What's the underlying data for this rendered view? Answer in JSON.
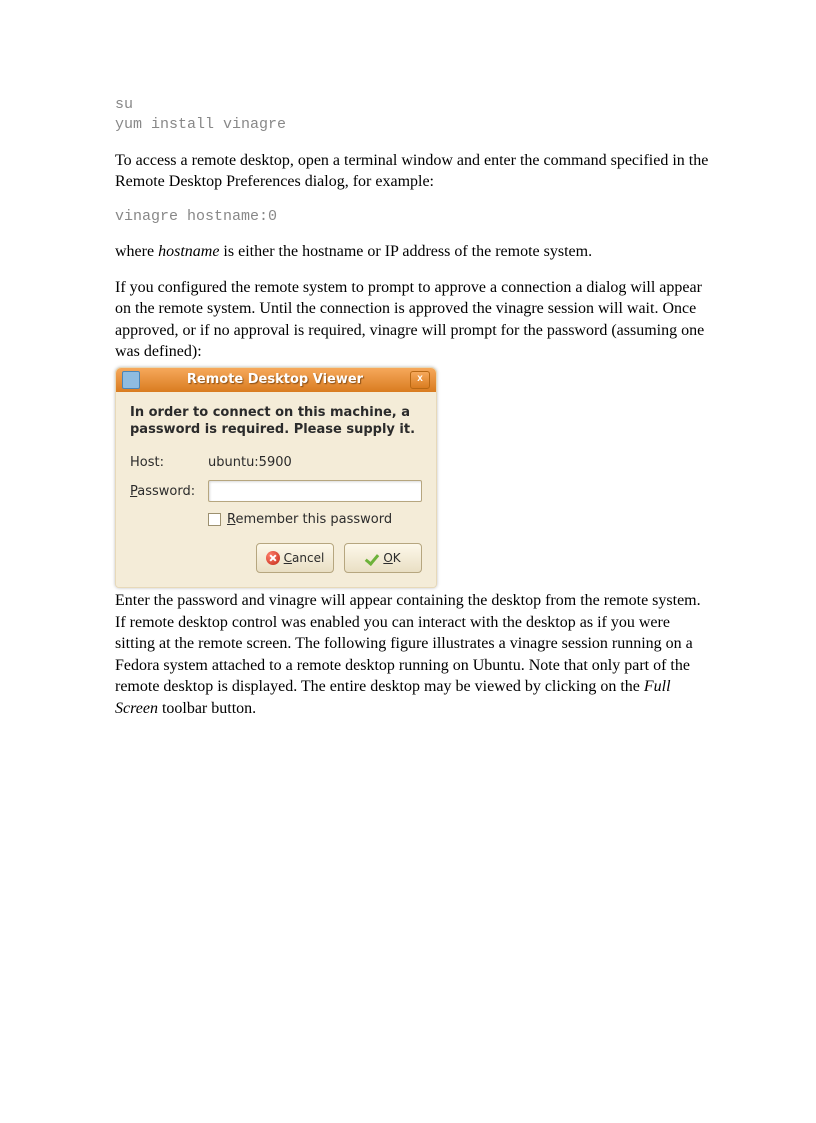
{
  "code": {
    "line1": "su",
    "line2": "yum install vinagre",
    "line3": "vinagre hostname:0"
  },
  "text": {
    "p1": "To access a remote desktop, open a terminal window and enter the command specified in the Remote Desktop Preferences dialog, for example:",
    "p2a": "where ",
    "p2i": "hostname",
    "p2b": " is either the hostname or IP address of the remote system.",
    "p3": "If you configured the remote system to prompt to approve a connection a dialog will appear on the remote system. Until the connection is approved the vinagre session will wait. Once approved, or if no approval is required, vinagre will prompt for the password (assuming one was defined):",
    "p4a": "Enter the password and vinagre will appear containing the desktop from the remote system. If remote desktop control was enabled you can interact with the desktop as if you were sitting at the remote screen. The following figure illustrates a vinagre session running on a Fedora system attached to a remote desktop running on Ubuntu. Note that only part of the remote desktop is displayed. The entire desktop may be viewed by clicking on the ",
    "p4i": "Full Screen",
    "p4b": " toolbar button."
  },
  "dialog": {
    "title": "Remote Desktop Viewer",
    "close_glyph": "x",
    "message": "In order to connect on this machine, a password is required. Please supply it.",
    "host_label": "Host:",
    "host_value": "ubuntu:5900",
    "password_label_pre": "P",
    "password_label_rest": "assword:",
    "remember_pre": "R",
    "remember_rest": "emember this password",
    "cancel_pre": "C",
    "cancel_rest": "ancel",
    "ok_pre": "O",
    "ok_rest": "K"
  }
}
